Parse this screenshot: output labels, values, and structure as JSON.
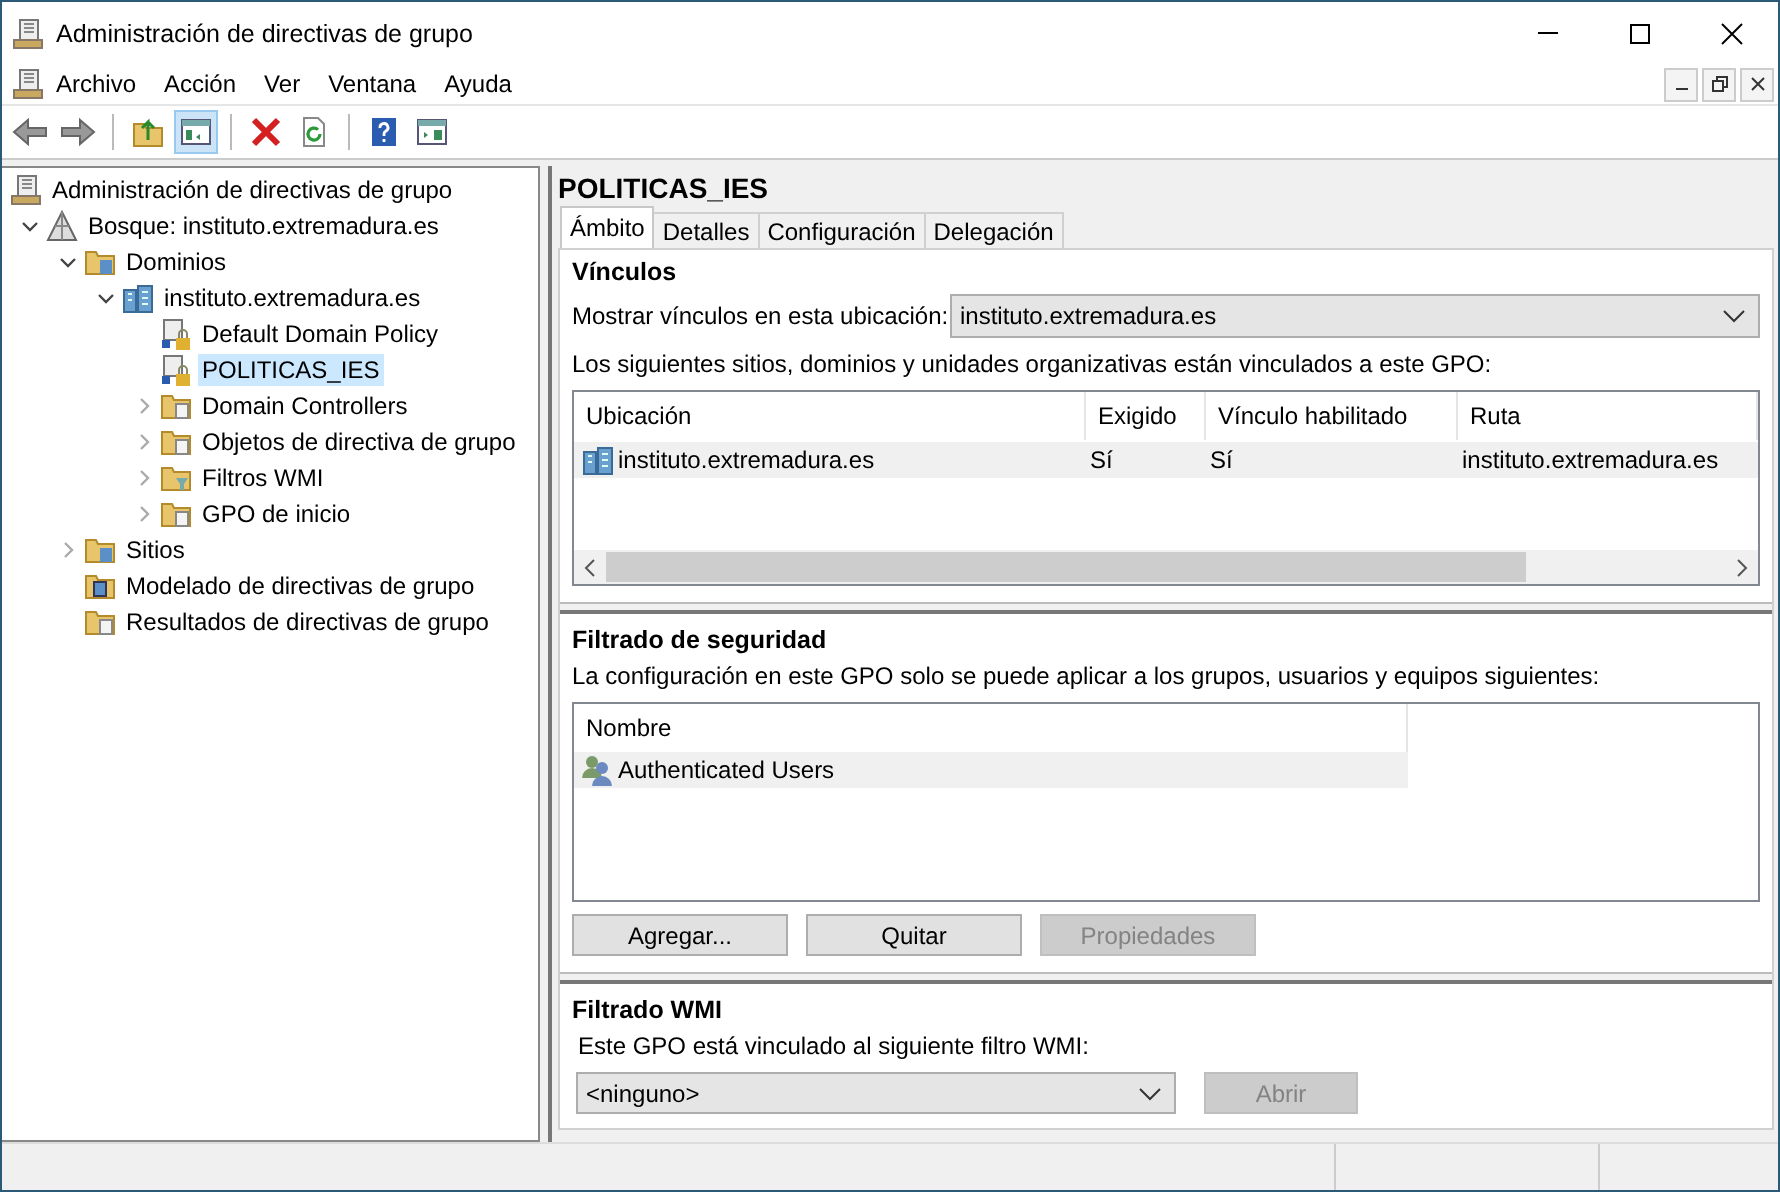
{
  "window": {
    "title": "Administración de directivas de grupo"
  },
  "menu": [
    "Archivo",
    "Acción",
    "Ver",
    "Ventana",
    "Ayuda"
  ],
  "toolbar": [
    {
      "kind": "back",
      "on": false
    },
    {
      "kind": "forward",
      "on": false
    },
    {
      "kind": "sep"
    },
    {
      "kind": "up",
      "on": false
    },
    {
      "kind": "tree",
      "on": true
    },
    {
      "kind": "sep"
    },
    {
      "kind": "delete",
      "on": false
    },
    {
      "kind": "refresh",
      "on": false
    },
    {
      "kind": "sep"
    },
    {
      "kind": "help",
      "on": false
    },
    {
      "kind": "pane",
      "on": false
    }
  ],
  "tree": {
    "label": "Administración de directivas de grupo",
    "kind": "root",
    "selected": false,
    "children": [
      {
        "label": "Bosque: instituto.extremadura.es",
        "kind": "forest",
        "selected": false,
        "expanded": true,
        "children": [
          {
            "label": "Dominios",
            "kind": "domains",
            "selected": false,
            "expanded": true,
            "children": [
              {
                "label": "instituto.extremadura.es",
                "kind": "domain",
                "selected": false,
                "expanded": true,
                "children": [
                  {
                    "label": "Default Domain Policy",
                    "kind": "gpo",
                    "selected": false
                  },
                  {
                    "label": "POLITICAS_IES",
                    "kind": "gpo",
                    "selected": true
                  },
                  {
                    "label": "Domain Controllers",
                    "kind": "ou",
                    "selected": false,
                    "expanded": false
                  },
                  {
                    "label": "Objetos de directiva de grupo",
                    "kind": "gpofolder",
                    "selected": false,
                    "expanded": false
                  },
                  {
                    "label": "Filtros WMI",
                    "kind": "filter",
                    "selected": false,
                    "expanded": false
                  },
                  {
                    "label": "GPO de inicio",
                    "kind": "starter",
                    "selected": false,
                    "expanded": false
                  }
                ]
              }
            ]
          },
          {
            "label": "Sitios",
            "kind": "sites",
            "selected": false,
            "expanded": false
          },
          {
            "label": "Modelado de directivas de grupo",
            "kind": "modeling",
            "selected": false
          },
          {
            "label": "Resultados de directivas de grupo",
            "kind": "results",
            "selected": false
          }
        ]
      }
    ]
  },
  "details": {
    "title": "POLITICAS_IES",
    "tabs": [
      {
        "label": "Ámbito",
        "selected": true
      },
      {
        "label": "Detalles",
        "selected": false
      },
      {
        "label": "Configuración",
        "selected": false
      },
      {
        "label": "Delegación",
        "selected": false
      }
    ],
    "links": {
      "heading": "Vínculos",
      "location_label": "Mostrar vínculos en esta ubicación:",
      "location_value": "instituto.extremadura.es",
      "description": "Los siguientes sitios, dominios y unidades organizativas están vinculados a este GPO:",
      "columns": [
        "Ubicación",
        "Exigido",
        "Vínculo habilitado",
        "Ruta"
      ],
      "rows": [
        {
          "cells": [
            "instituto.extremadura.es",
            "Sí",
            "Sí",
            "instituto.extremadura.es"
          ],
          "selected": true
        }
      ]
    },
    "security": {
      "heading": "Filtrado de seguridad",
      "description": "La configuración en este GPO solo se puede aplicar a los grupos, usuarios y equipos siguientes:",
      "columns": [
        "Nombre"
      ],
      "rows": [
        {
          "name": "Authenticated Users",
          "selected": true
        }
      ],
      "buttons": [
        {
          "label": "Agregar...",
          "disabled": false
        },
        {
          "label": "Quitar",
          "disabled": false
        },
        {
          "label": "Propiedades",
          "disabled": true
        }
      ]
    },
    "wmi": {
      "heading": "Filtrado WMI",
      "description": "Este GPO está vinculado al siguiente filtro WMI:",
      "value": "<ninguno>",
      "button": {
        "label": "Abrir",
        "disabled": true
      }
    }
  }
}
